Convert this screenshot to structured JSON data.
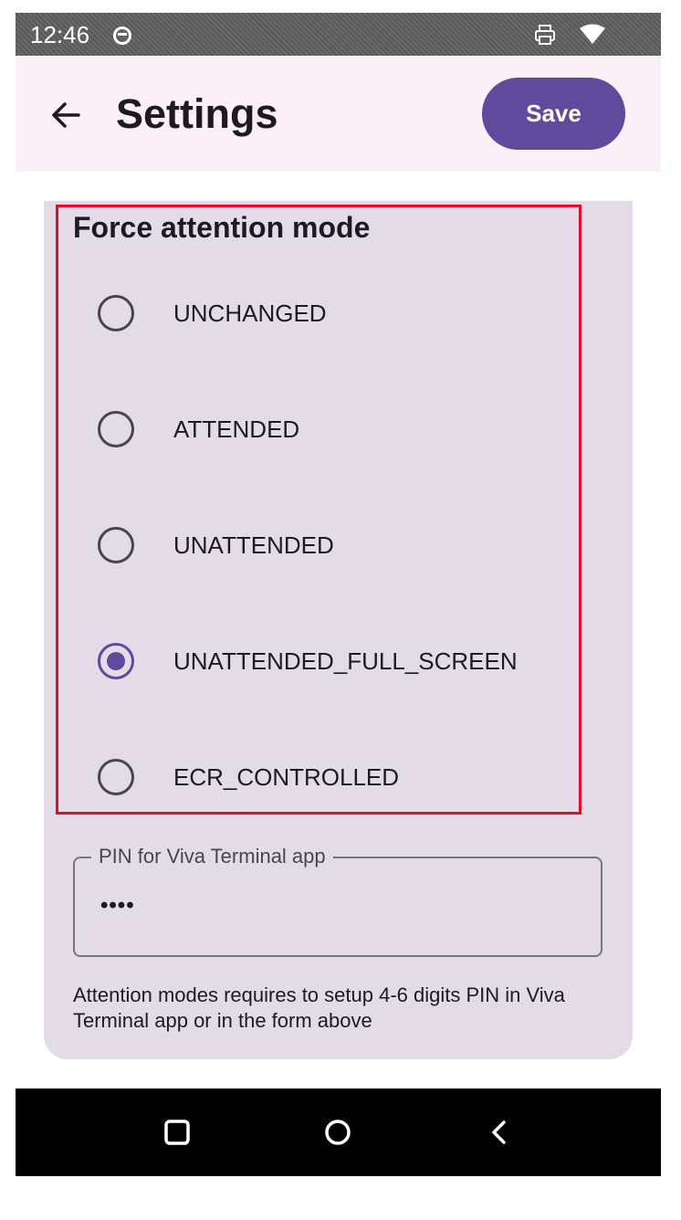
{
  "status_bar": {
    "time": "12:46",
    "icons": [
      "notification-icon",
      "print-icon",
      "wifi-icon"
    ]
  },
  "app_bar": {
    "back_icon": "arrow-left-icon",
    "title": "Settings",
    "save_label": "Save"
  },
  "attention_mode": {
    "title": "Force attention mode",
    "options": [
      {
        "label": "UNCHANGED",
        "selected": false
      },
      {
        "label": "ATTENDED",
        "selected": false
      },
      {
        "label": "UNATTENDED",
        "selected": false
      },
      {
        "label": "UNATTENDED_FULL_SCREEN",
        "selected": true
      },
      {
        "label": "ECR_CONTROLLED",
        "selected": false
      }
    ]
  },
  "pin_field": {
    "label": "PIN for Viva Terminal app",
    "value": "••••"
  },
  "helper_text": "Attention modes requires to setup 4-6 digits PIN in Viva Terminal app or in the form above",
  "nav_bar": {
    "items": [
      "recents-square-icon",
      "home-circle-icon",
      "back-chevron-icon"
    ]
  },
  "colors": {
    "accent": "#604a9c",
    "app_bar_bg": "#fcf0f8",
    "card_bg": "#e3dce6",
    "highlight_border": "#e0102c",
    "status_bar_bg": "#5f5f5f",
    "nav_bar_bg": "#000000"
  }
}
